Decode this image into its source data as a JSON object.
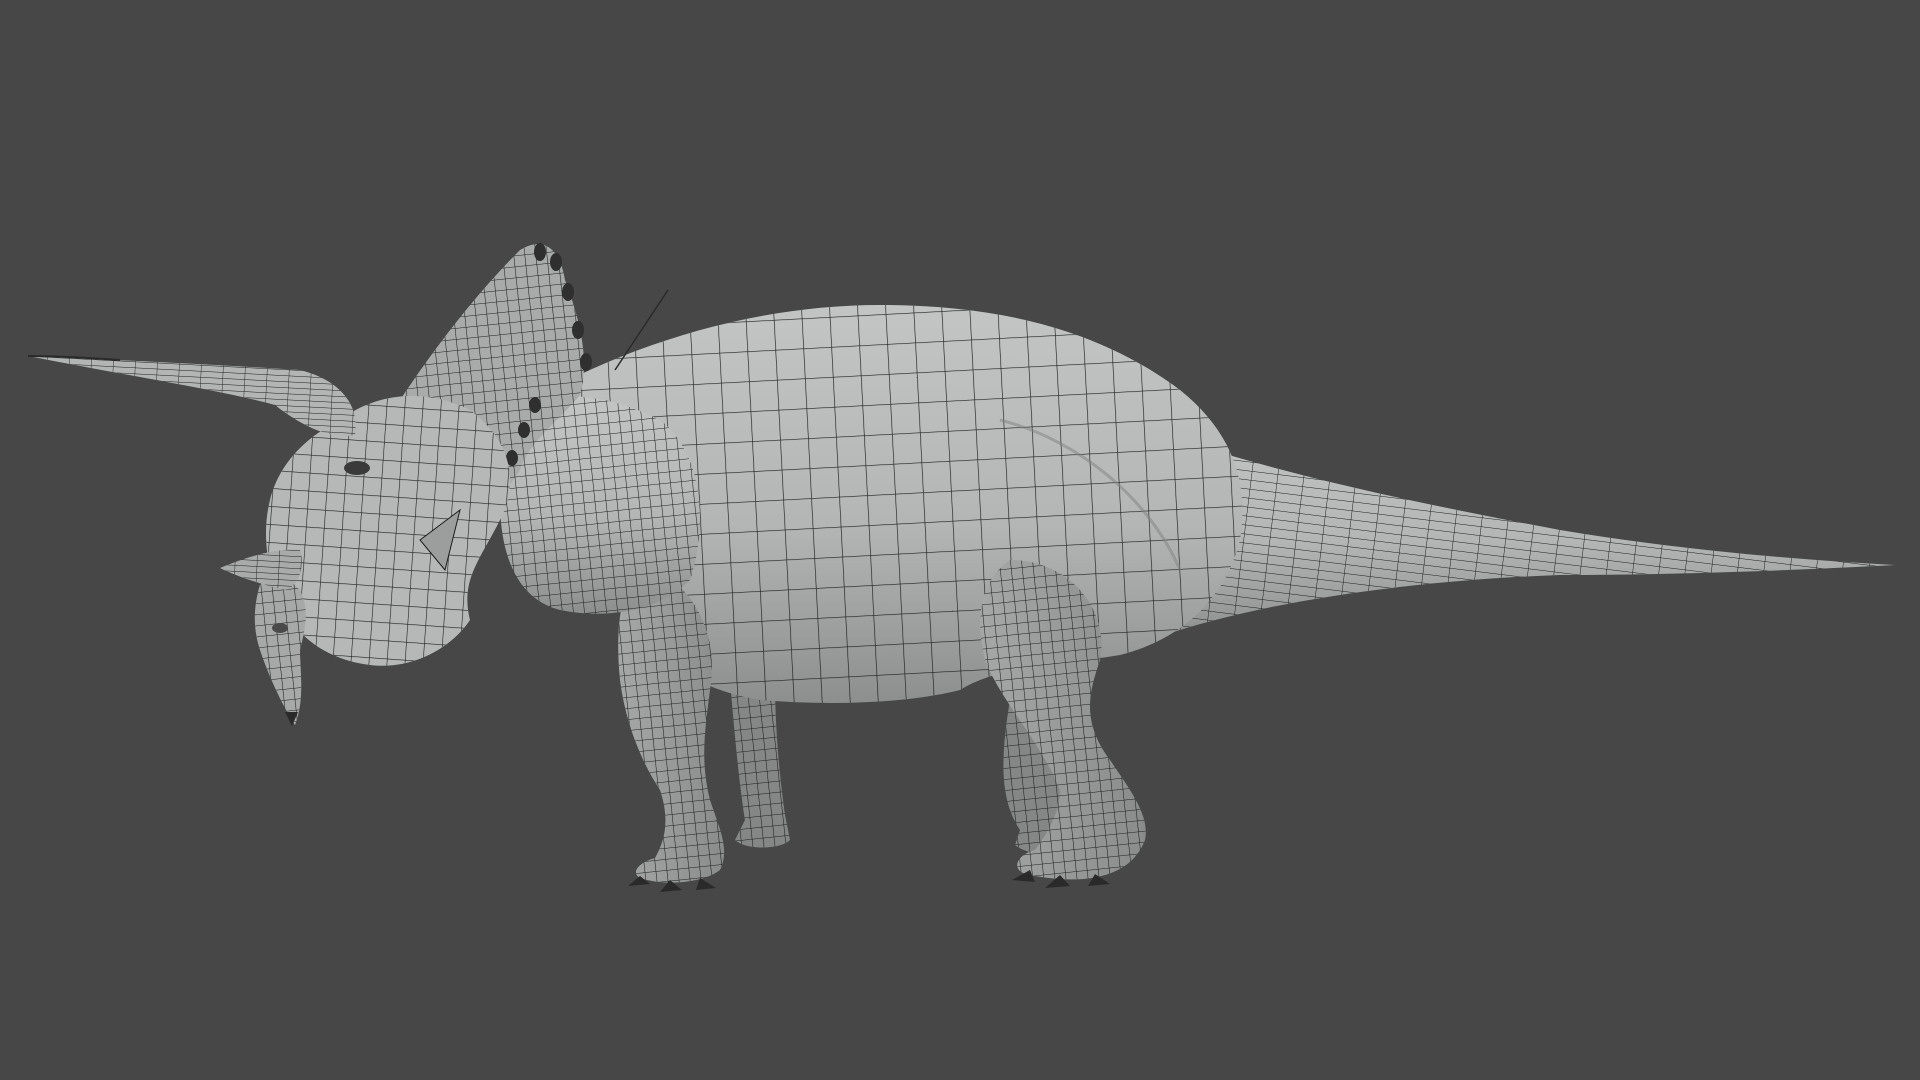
{
  "viewport": {
    "background_color": "#474747",
    "model": {
      "subject": "triceratops",
      "display_mode": "wireframe-on-shaded",
      "surface_color": "#b9bbbb",
      "wire_color": "#1c1c1c"
    }
  }
}
